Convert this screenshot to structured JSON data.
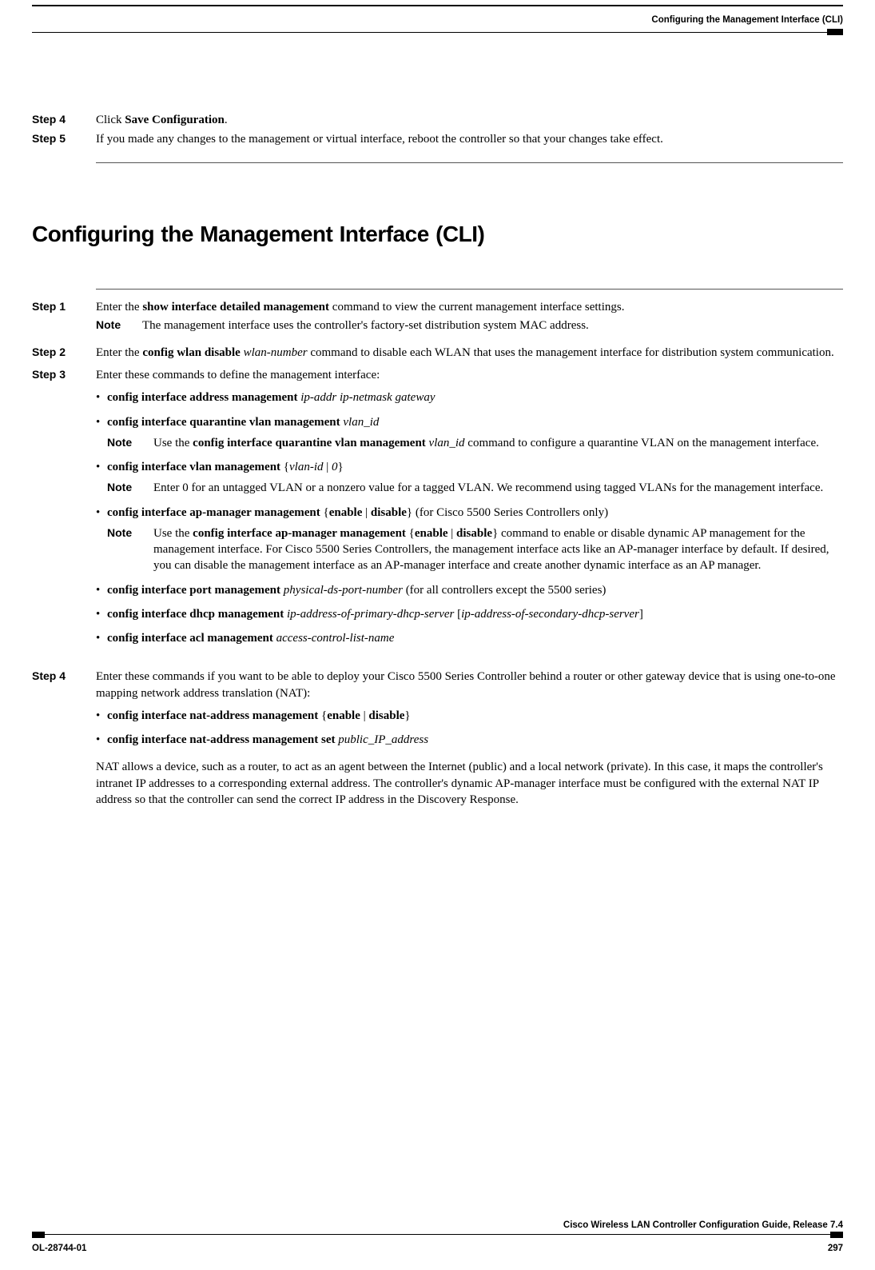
{
  "header": {
    "right_text": "Configuring the Management Interface (CLI)"
  },
  "pre_steps": {
    "step4": {
      "label": "Step 4",
      "text_a": "Click ",
      "text_b": "Save Configuration",
      "text_c": "."
    },
    "step5": {
      "label": "Step 5",
      "text": "If you made any changes to the management or virtual interface, reboot the controller so that your changes take effect."
    }
  },
  "section_title": "Configuring the Management Interface (CLI)",
  "steps": {
    "s1": {
      "label": "Step 1",
      "t1": "Enter the ",
      "t2": "show interface detailed management",
      "t3": " command to view the current management interface settings.",
      "note_label": "Note",
      "note_text": "The management interface uses the controller's factory-set distribution system MAC address."
    },
    "s2": {
      "label": "Step 2",
      "t1": "Enter the ",
      "t2": "config wlan disable",
      "t2b": " wlan-number",
      "t3": " command to disable each WLAN that uses the management interface for distribution system communication."
    },
    "s3": {
      "label": "Step 3",
      "t1": "Enter these commands to define the management interface:",
      "b1": {
        "a": "config interface address management",
        "b": " ip-addr ip-netmask gateway"
      },
      "b2": {
        "a": "config interface quarantine vlan management",
        "b": " vlan_id",
        "note_label": "Note",
        "n1": "Use the ",
        "n2": "config interface quarantine vlan management",
        "n2b": " vlan_id",
        "n3": " command to configure a quarantine VLAN on the management interface."
      },
      "b3": {
        "a": "config interface vlan management",
        "b": " {",
        "c": "vlan-id",
        "d": " | ",
        "e": "0",
        "f": "}",
        "note_label": "Note",
        "n": "Enter 0 for an untagged VLAN or a nonzero value for a tagged VLAN. We recommend using tagged VLANs for the management interface."
      },
      "b4": {
        "a": "config interface ap-manager management",
        "b": " {",
        "c": "enable",
        "d": " | ",
        "e": "disable",
        "f": "} (for Cisco 5500 Series Controllers only)",
        "note_label": "Note",
        "n1": "Use the ",
        "n2": "config interface ap-manager management",
        "n3": " {",
        "n4": "enable",
        "n5": " | ",
        "n6": "disable",
        "n7": "} command to enable or disable dynamic AP management for the management interface. For Cisco 5500 Series Controllers, the management interface acts like an AP-manager interface by default. If desired, you can disable the management interface as an AP-manager interface and create another dynamic interface as an AP manager."
      },
      "b5": {
        "a": "config interface port management",
        "b": " physical-ds-port-number",
        "c": " (for all controllers except the 5500 series)"
      },
      "b6": {
        "a": "config interface dhcp management",
        "b": " ip-address-of-primary-dhcp-server",
        "c": " [",
        "d": "ip-address-of-secondary-dhcp-server",
        "e": "]"
      },
      "b7": {
        "a": "config interface acl management",
        "b": " access-control-list-name"
      }
    },
    "s4": {
      "label": "Step 4",
      "t1": "Enter these commands if you want to be able to deploy your Cisco 5500 Series Controller behind a router or other gateway device that is using one-to-one mapping network address translation (NAT):",
      "b1": {
        "a": "config interface nat-address management",
        "b": " {",
        "c": "enable",
        "d": " | ",
        "e": "disable",
        "f": "}"
      },
      "b2": {
        "a": "config interface nat-address management set",
        "b": " public_IP_address"
      },
      "p": "NAT allows a device, such as a router, to act as an agent between the Internet (public) and a local network (private). In this case, it maps the controller's intranet IP addresses to a corresponding external address. The controller's dynamic AP-manager interface must be configured with the external NAT IP address so that the controller can send the correct IP address in the Discovery Response."
    }
  },
  "footer": {
    "title": "Cisco Wireless LAN Controller Configuration Guide, Release 7.4",
    "left": "OL-28744-01",
    "right": "297"
  }
}
